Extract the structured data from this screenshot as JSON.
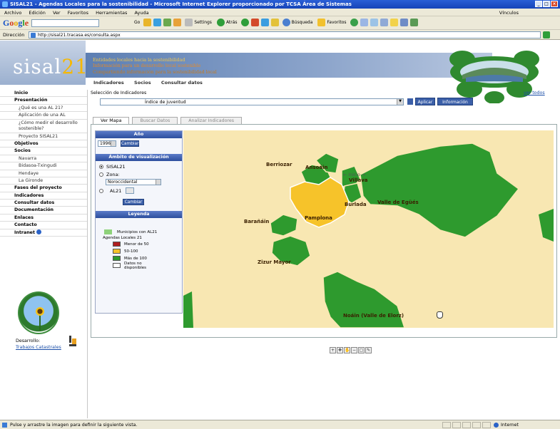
{
  "window": {
    "title": "SISAL21 - Agendas Locales para la sostenibilidad - Microsoft Internet Explorer proporcionado por TCSA Área de Sistemas"
  },
  "menubar": {
    "items": [
      "Archivo",
      "Edición",
      "Ver",
      "Favoritos",
      "Herramientas",
      "Ayuda"
    ],
    "vinculos": "Vínculos"
  },
  "toolbar": {
    "google_search_placeholder": "",
    "go_label": "Go",
    "settings_label": "Settings",
    "back_label": "Atrás",
    "search_label": "Búsqueda",
    "favorites_label": "Favoritos"
  },
  "addressbar": {
    "label": "Dirección",
    "url": "http://sisal21.tracasa.es/consulta.aspx"
  },
  "banner": {
    "logo_text": "sisal",
    "logo_number": "21",
    "tagline1": "Entidades locales hacia la sostenibilidad",
    "tagline2": "Información para un desarrollo local sostenible",
    "tagline3": "Compartiendo información para la sostenibilidad local",
    "topnav": [
      "Indicadores",
      "Socios",
      "Consultar datos"
    ]
  },
  "sidebar": {
    "items": [
      {
        "label": "Inicio",
        "type": "main"
      },
      {
        "label": "Presentación",
        "type": "main"
      },
      {
        "label": "¿Qué es una AL 21?",
        "type": "sub"
      },
      {
        "label": "Aplicación de una AL",
        "type": "sub"
      },
      {
        "label": "¿Cómo medir el desarrollo sostenible?",
        "type": "sub-tall"
      },
      {
        "label": "Proyecto SISAL21",
        "type": "sub"
      },
      {
        "label": "Objetivos",
        "type": "main"
      },
      {
        "label": "Socios",
        "type": "main"
      },
      {
        "label": "Navarra",
        "type": "sub"
      },
      {
        "label": "Bidasoa-Txingudi",
        "type": "sub"
      },
      {
        "label": "Hendaye",
        "type": "sub"
      },
      {
        "label": "La Gironde",
        "type": "sub"
      },
      {
        "label": "Fases del proyecto",
        "type": "main"
      },
      {
        "label": "Indicadores",
        "type": "main"
      },
      {
        "label": "Consultar datos",
        "type": "main"
      },
      {
        "label": "Documentación",
        "type": "main"
      },
      {
        "label": "Enlaces",
        "type": "main"
      },
      {
        "label": "Contacto",
        "type": "main"
      },
      {
        "label": "Intranet",
        "type": "main"
      }
    ],
    "developer_label": "Desarrollo:",
    "developer_link": "Trabajos Catastrales"
  },
  "main": {
    "selection_label": "Selección de Indicadores",
    "ver_todos": "ver todos",
    "indicator_value": "Índice de juventud",
    "aplicar": "Aplicar",
    "informacion": "Información",
    "tabs": [
      "Ver Mapa",
      "Buscar Datos",
      "Analizar Indicadores"
    ],
    "year_header": "Año",
    "year_value": "1996",
    "cambiar": "Cambiar",
    "scope_header": "Ámbito de visualización",
    "scope_options": [
      "SISAL21",
      "Zona:",
      "AL21"
    ],
    "zone_value": "Noroccidental",
    "legend_header": "Leyenda",
    "legend": {
      "municipios": "Municipios con AL21",
      "agendas_title": "Agendas Locales 21",
      "ranges": [
        {
          "label": "Menor de 50",
          "color": "#b01e1e"
        },
        {
          "label": "50-100",
          "color": "#f6c32a"
        },
        {
          "label": "Más de 100",
          "color": "#2e9a2e"
        },
        {
          "label": "Datos no disponibles",
          "color": "#ffffff"
        }
      ],
      "municipios_color": "#8ed27a"
    },
    "map_nav": "Inicio",
    "map_labels": [
      "Berriozar",
      "Ansoáin",
      "Villava",
      "Burlada",
      "Valle de Egüés",
      "Pamplona",
      "Barañáin",
      "Zizur Mayor",
      "Noáin (Valle de Elorz)"
    ]
  },
  "statusbar": {
    "message": "Pulse y arrastre la imagen para definir la siguiente vista.",
    "zone": "Internet"
  }
}
